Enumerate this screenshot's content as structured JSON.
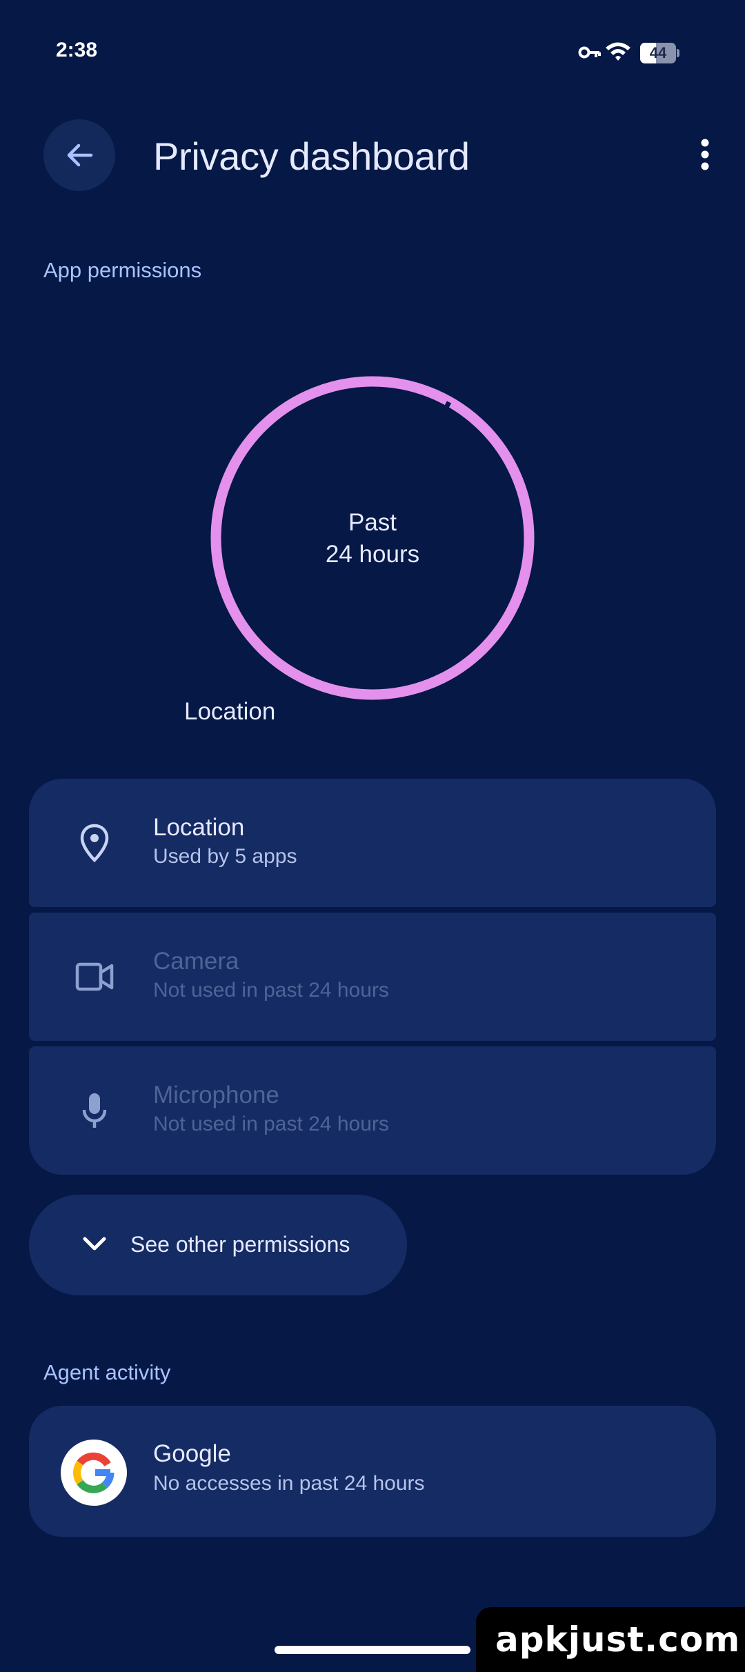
{
  "status_bar": {
    "time": "2:38",
    "battery_level": "44",
    "icons": [
      "vpn-key-icon",
      "wifi-icon",
      "battery-icon"
    ]
  },
  "app_bar": {
    "back_icon": "arrow-back-icon",
    "title": "Privacy dashboard",
    "more_icon": "more-vert-icon"
  },
  "app_permissions": {
    "header": "App permissions",
    "chart_center_line1": "Past",
    "chart_center_line2": "24 hours",
    "chart_segment_label": "Location",
    "chart_color": "#e391ec",
    "items": [
      {
        "icon": "location-pin-icon",
        "title": "Location",
        "subtitle": "Used by 5 apps",
        "enabled": true
      },
      {
        "icon": "camera-icon",
        "title": "Camera",
        "subtitle": "Not used in past 24 hours",
        "enabled": false
      },
      {
        "icon": "microphone-icon",
        "title": "Microphone",
        "subtitle": "Not used in past 24 hours",
        "enabled": false
      }
    ],
    "see_other_icon": "chevron-down-icon",
    "see_other_label": "See other permissions"
  },
  "agent_activity": {
    "header": "Agent activity",
    "items": [
      {
        "icon": "google-logo-icon",
        "title": "Google",
        "subtitle": "No accesses in past 24 hours"
      }
    ]
  },
  "watermark": "apkjust.com",
  "colors": {
    "background": "#061845",
    "card": "#152b63",
    "accent": "#a9c3ff",
    "chart_ring": "#e391ec"
  }
}
